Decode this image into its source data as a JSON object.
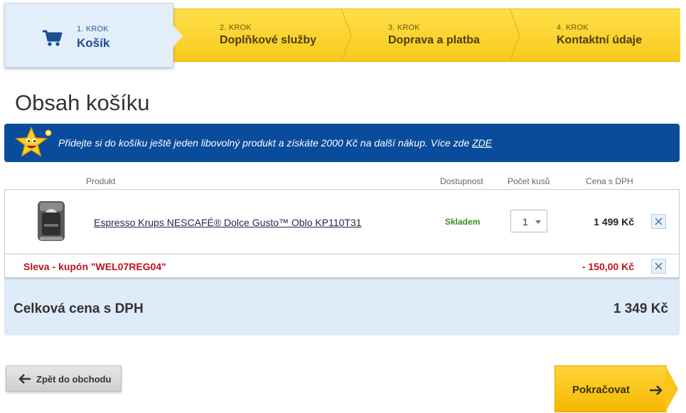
{
  "steps": [
    {
      "num": "1. KROK",
      "title": "Košík",
      "active": true
    },
    {
      "num": "2. KROK",
      "title": "Doplňkové služby",
      "active": false
    },
    {
      "num": "3. KROK",
      "title": "Doprava a platba",
      "active": false
    },
    {
      "num": "4. KROK",
      "title": "Kontaktní údaje",
      "active": false
    }
  ],
  "page_title": "Obsah košíku",
  "promo": {
    "text": "Přidejte si do košíku ještě jeden libovolný produkt a získáte 2000 Kč na další nákup. Více zde ",
    "link": "ZDE"
  },
  "table": {
    "headers": {
      "product": "Produkt",
      "availability": "Dostupnost",
      "quantity": "Počet kusů",
      "price": "Cena s DPH"
    },
    "items": [
      {
        "name": "Espresso Krups NESCAFÉ® Dolce Gusto™ Oblo KP110T31",
        "availability": "Skladem",
        "quantity": "1",
        "price": "1 499 Kč"
      }
    ],
    "discount": {
      "label": "Sleva - kupón \"WEL07REG04\"",
      "value": "- 150,00 Kč"
    }
  },
  "total": {
    "label": "Celková cena s DPH",
    "value": "1 349 Kč"
  },
  "buttons": {
    "back": "Zpět do obchodu",
    "next": "Pokračovat"
  },
  "colors": {
    "accent_blue": "#0a4c9c",
    "step_yellow": "#ffd43a",
    "stock_green": "#3f8a1f",
    "discount_red": "#c0121a"
  },
  "icons": {
    "cart": "shopping-cart-icon",
    "remove": "close-icon",
    "back": "arrow-left-icon",
    "next": "arrow-right-icon",
    "mascot": "star-mascot"
  }
}
